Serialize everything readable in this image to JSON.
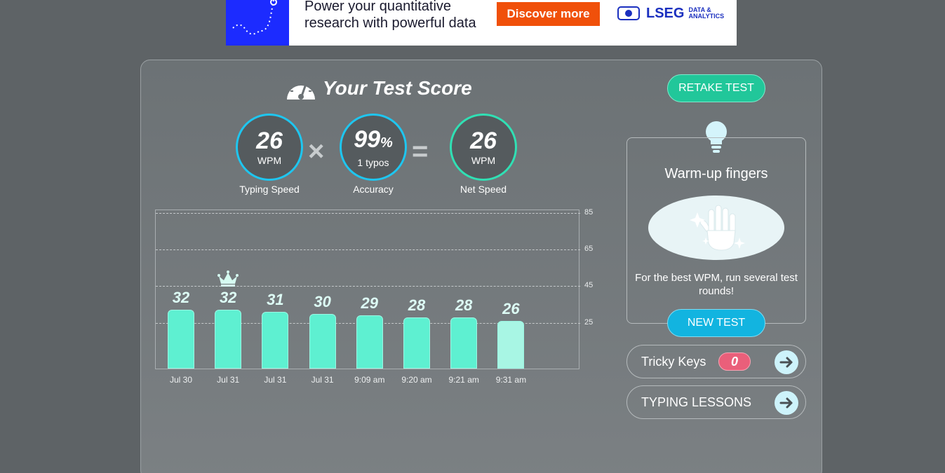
{
  "ad": {
    "headline_line1": "Power your quantitative",
    "headline_line2": "research with powerful data",
    "cta": "Discover more",
    "brand": "LSEG",
    "brand_sub_line1": "DATA &",
    "brand_sub_line2": "ANALYTICS"
  },
  "result": {
    "title": "Your Test Score",
    "typing_speed": {
      "value": "26",
      "unit": "WPM",
      "label": "Typing Speed"
    },
    "accuracy": {
      "value": "99",
      "suffix": "%",
      "typos": "1 typos",
      "label": "Accuracy"
    },
    "net_speed": {
      "value": "26",
      "unit": "WPM",
      "label": "Net Speed"
    },
    "times_symbol": "×",
    "equals_symbol": "="
  },
  "chart_data": {
    "type": "bar",
    "categories": [
      "Jul 30",
      "Jul 31",
      "Jul 31",
      "Jul 31",
      "9:09 am",
      "9:20 am",
      "9:21 am",
      "9:31 am"
    ],
    "values": [
      32,
      32,
      31,
      30,
      29,
      28,
      28,
      26
    ],
    "yticks": [
      85,
      65,
      45,
      25
    ],
    "ylim": [
      0,
      85
    ],
    "best_index": 1,
    "latest_index": 7,
    "grid": true,
    "colors": {
      "bar": "#5ef0d1",
      "latest": "#a8f6e4"
    }
  },
  "sidebar": {
    "retake_label": "RETAKE TEST",
    "warmup_title": "Warm-up fingers",
    "warmup_desc": "For the best WPM, run several test rounds!",
    "new_test_label": "NEW TEST",
    "tricky_keys_label": "Tricky Keys",
    "tricky_keys_count": "0",
    "lessons_label": "TYPING LESSONS"
  }
}
